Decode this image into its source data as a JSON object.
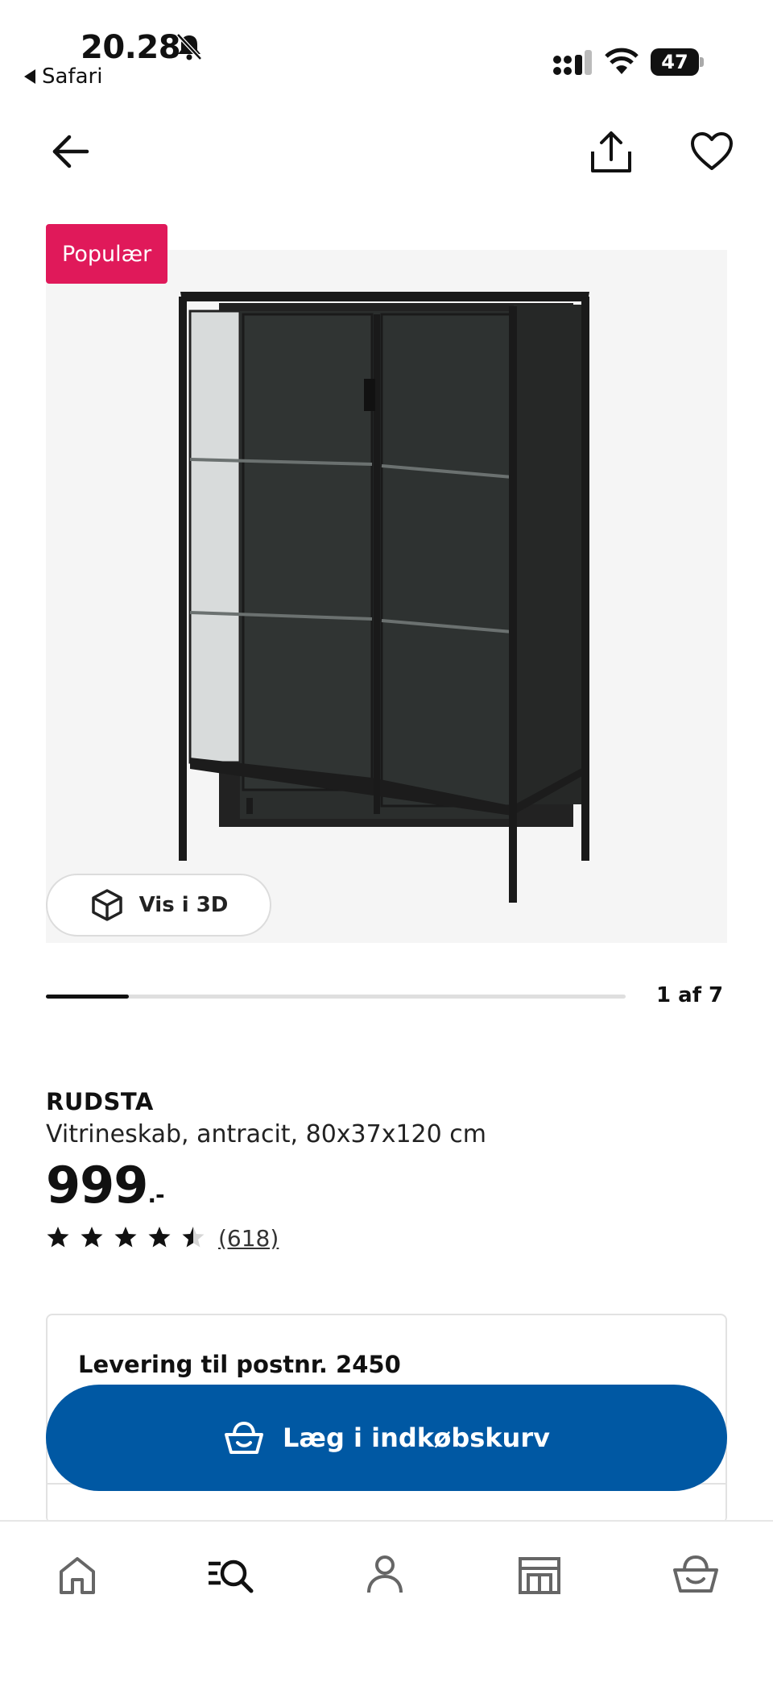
{
  "status_bar": {
    "time": "20.28",
    "back_app": "Safari",
    "battery": "47"
  },
  "header": {
    "back_icon": "arrow-left-icon",
    "share_icon": "share-icon",
    "favorite_icon": "heart-icon"
  },
  "gallery": {
    "badge": "Populær",
    "view_3d_label": "Vis i 3D",
    "current": 1,
    "total": 7,
    "progress_label": "1 af 7",
    "progress_fraction": 0.143
  },
  "product": {
    "name": "RUDSTA",
    "description": "Vitrineskab, antracit, 80x37x120 cm",
    "price": "999",
    "price_suffix": ".-",
    "rating": 4.5,
    "review_count": "(618)"
  },
  "delivery": {
    "title": "Levering til postnr. 2450"
  },
  "cart": {
    "label": "Læg i indkøbskurv"
  },
  "tab_bar": {
    "items": [
      "home-icon",
      "search-icon",
      "profile-icon",
      "store-icon",
      "basket-icon"
    ]
  },
  "colors": {
    "badge": "#e0195a",
    "primary": "#0058a3"
  }
}
